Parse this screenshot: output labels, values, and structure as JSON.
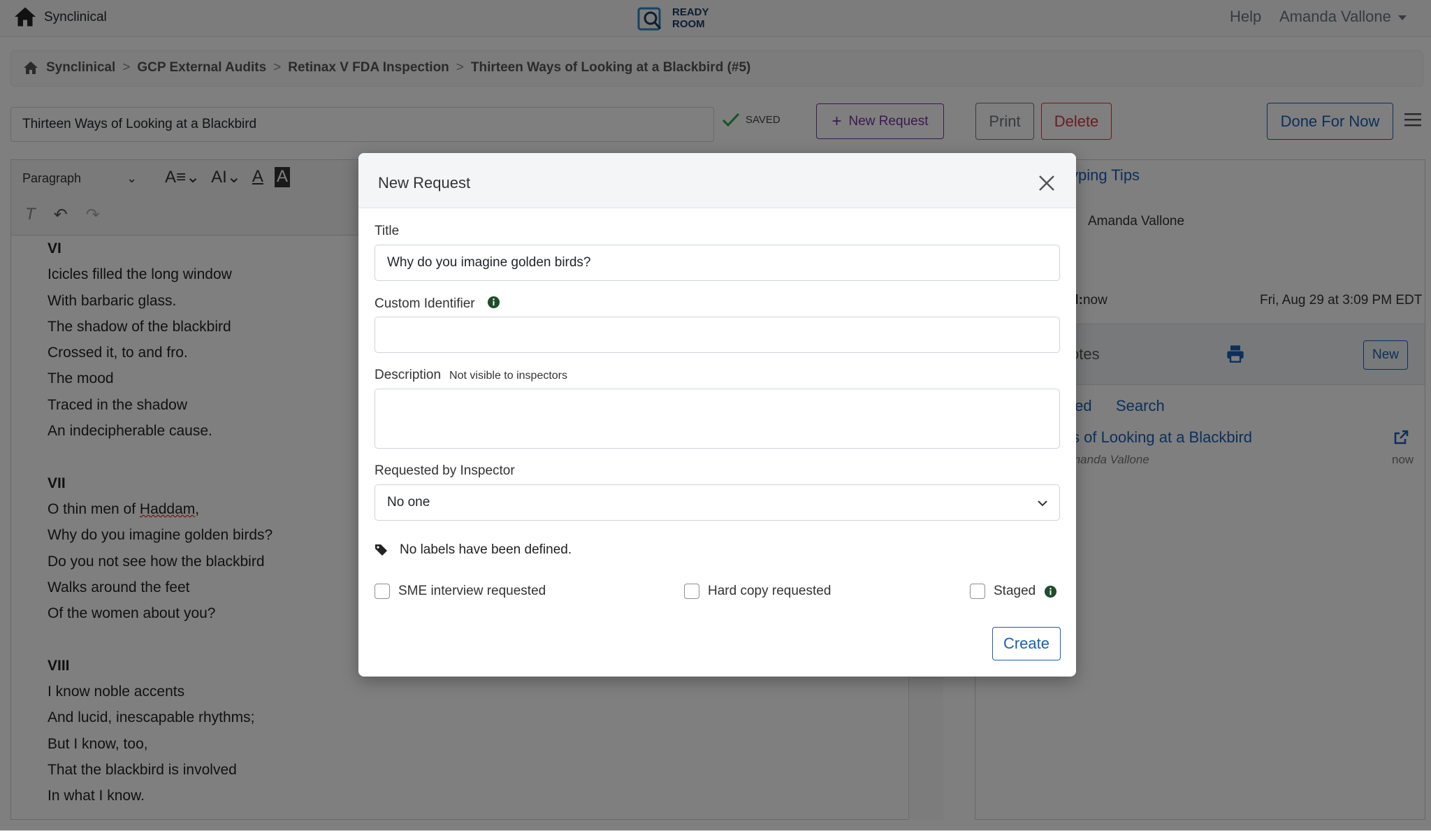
{
  "app": {
    "name": "Synclinical",
    "logo_text_line1": "READY",
    "logo_text_line2": "ROOM"
  },
  "topnav": {
    "help": "Help",
    "user": "Amanda Vallone"
  },
  "breadcrumb": {
    "items": [
      "Synclinical",
      "GCP External Audits",
      "Retinax V FDA Inspection",
      "Thirteen Ways of Looking at a Blackbird (#5)"
    ],
    "separator": ">"
  },
  "titlebar": {
    "title_value": "Thirteen Ways of Looking at a Blackbird",
    "saved": "SAVED",
    "new_request": "New Request",
    "print": "Print",
    "delete": "Delete",
    "done": "Done For Now"
  },
  "editor": {
    "paragraph_style": "Paragraph",
    "poem": [
      {
        "type": "heading",
        "text": "VI"
      },
      {
        "type": "line",
        "text": "Icicles filled the long window"
      },
      {
        "type": "line",
        "text": "With barbaric glass."
      },
      {
        "type": "line",
        "text": "The shadow of the blackbird"
      },
      {
        "type": "line",
        "text": "Crossed it, to and fro."
      },
      {
        "type": "line",
        "text": "The mood"
      },
      {
        "type": "line",
        "text": "Traced in the shadow"
      },
      {
        "type": "line",
        "text": "An indecipherable cause."
      },
      {
        "type": "gap",
        "text": ""
      },
      {
        "type": "heading",
        "text": "VII"
      },
      {
        "type": "line",
        "text": "O thin men of Haddam,"
      },
      {
        "type": "line",
        "text": "Why do you imagine golden birds?"
      },
      {
        "type": "line",
        "text": "Do you not see how the blackbird"
      },
      {
        "type": "line",
        "text": "Walks around the feet"
      },
      {
        "type": "line",
        "text": "Of the women about you?"
      },
      {
        "type": "gap",
        "text": ""
      },
      {
        "type": "heading",
        "text": "VIII"
      },
      {
        "type": "line",
        "text": "I know noble accents"
      },
      {
        "type": "line",
        "text": "And lucid, inescapable rhythms;"
      },
      {
        "type": "line",
        "text": "But I know, too,"
      },
      {
        "type": "line",
        "text": "That the blackbird is involved"
      },
      {
        "type": "line",
        "text": "In what I know."
      }
    ]
  },
  "right_panel": {
    "tips": "yping Tips",
    "author": "Amanda Vallone",
    "colon": ":",
    "modified_label": "d:",
    "modified_value": "now",
    "date": "Fri, Aug 29 at 3:09 PM EDT",
    "notes": "otes",
    "new_button": "New",
    "tab_a": "ted",
    "tab_b": "Search",
    "link": "s of Looking at a Blackbird",
    "sub": "manda Vallone",
    "now": "now"
  },
  "modal": {
    "title": "New Request",
    "title_label": "Title",
    "title_value": "Why do you imagine golden birds?",
    "custom_id_label": "Custom Identifier",
    "custom_id_value": "",
    "description_label": "Description",
    "description_hint": "Not visible to inspectors",
    "requested_by_label": "Requested by Inspector",
    "requested_by_value": "No one",
    "labels_text": "No labels have been defined.",
    "check_sme": "SME interview requested",
    "check_hardcopy": "Hard copy requested",
    "check_staged": "Staged",
    "create": "Create"
  },
  "colors": {
    "primary": "#1a5fb4",
    "purple": "#7b2fa4",
    "danger": "#dc3545",
    "info_green": "#1e4d2b"
  }
}
